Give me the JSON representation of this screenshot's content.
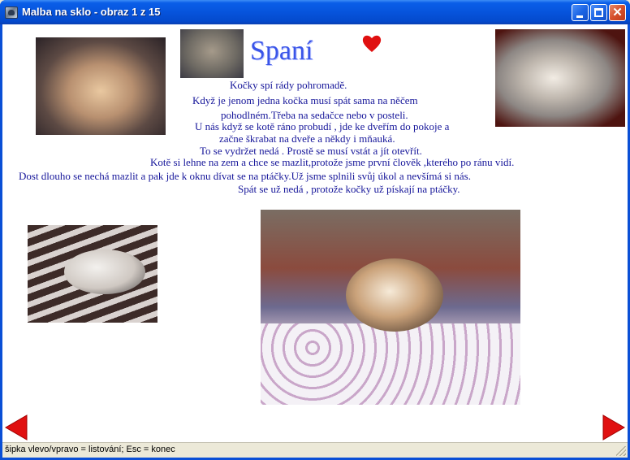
{
  "window": {
    "title": "Malba na sklo - obraz 1 z 15"
  },
  "page": {
    "heading": "Spaní",
    "lines": [
      "Kočky spí rády pohromadě.",
      "Když je jenom jedna kočka musí spát sama na něčem",
      "pohodlném.Třeba na sedačce nebo v posteli.",
      "U nás když se kotě  ráno  probudí , jde ke dveřím do pokoje a",
      "začne škrabat na dveře a někdy i mňauká.",
      "To se vydržet nedá . Prostě se musí vstát a jít otevřít.",
      "Kotě si lehne na zem a chce se mazlit,protože jsme první člověk ,kterého po ránu vidí.",
      "Dost dlouho se nechá mazlit a pak jde k oknu dívat se na ptáčky.Už jsme splnili svůj úkol a nevšímá si nás.",
      "Spát se už nedá , protože kočky už pískají na ptáčky."
    ]
  },
  "statusbar": {
    "text": "šipka vlevo/vpravo = listování;   Esc = konec"
  },
  "icons": {
    "nav_prev": "red-left-arrow-icon",
    "nav_next": "red-right-arrow-icon",
    "decoration": "red-heart-icon"
  },
  "colors": {
    "titlebar": "#0654dc",
    "heading": "#3a55e8",
    "text": "#16169a",
    "arrow": "#e01010",
    "heart": "#e01010"
  }
}
